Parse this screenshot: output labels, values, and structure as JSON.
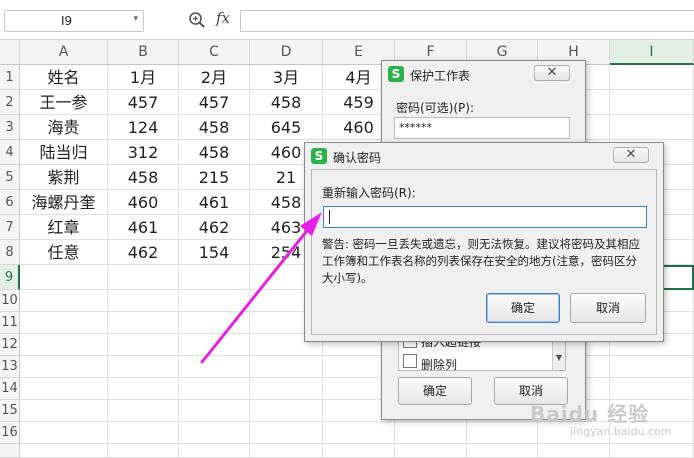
{
  "formula_bar": {
    "name_box": "I9",
    "fx_label": "fx",
    "formula_value": ""
  },
  "columns": [
    "A",
    "B",
    "C",
    "D",
    "E",
    "F",
    "G",
    "H",
    "I"
  ],
  "rows": [
    "1",
    "2",
    "3",
    "4",
    "5",
    "6",
    "7",
    "8",
    "9",
    "10",
    "11",
    "12",
    "13",
    "14",
    "15",
    "16"
  ],
  "table": [
    [
      "姓名",
      "1月",
      "2月",
      "3月",
      "4月"
    ],
    [
      "王一参",
      "457",
      "457",
      "458",
      "459"
    ],
    [
      "海贵",
      "124",
      "458",
      "645",
      "460"
    ],
    [
      "陆当归",
      "312",
      "458",
      "460",
      ""
    ],
    [
      "紫荆",
      "458",
      "215",
      "21",
      ""
    ],
    [
      "海螺丹奎",
      "460",
      "461",
      "458",
      ""
    ],
    [
      "红章",
      "461",
      "462",
      "463",
      ""
    ],
    [
      "任意",
      "462",
      "154",
      "254",
      ""
    ]
  ],
  "protect_dialog": {
    "title": "保护工作表",
    "password_label": "密码(可选)(P):",
    "password_value": "******",
    "list_item": "插入超链接",
    "list_item_partial": "删除列",
    "ok_label": "确定",
    "cancel_label": "取消"
  },
  "confirm_dialog": {
    "title": "确认密码",
    "reenter_label": "重新输入密码(R):",
    "password_value": "",
    "warning_text": "警告: 密码一旦丢失或遗忘，则无法恢复。建议将密码及其相应工作簿和工作表名称的列表保存在安全的地方(注意，密码区分大小写)。",
    "ok_label": "确定",
    "cancel_label": "取消"
  },
  "watermark": {
    "brand": "Baidu 经验",
    "sub": "jingyan.baidu.com"
  },
  "colors": {
    "accent_green": "#217346",
    "arrow_magenta": "#e81ee8",
    "wps_logo_green": "#2bb14a"
  },
  "icons": [
    "zoom-icon",
    "fx-icon",
    "close-icon",
    "checkbox-icon",
    "scroll-down-icon",
    "wps-logo-icon"
  ]
}
